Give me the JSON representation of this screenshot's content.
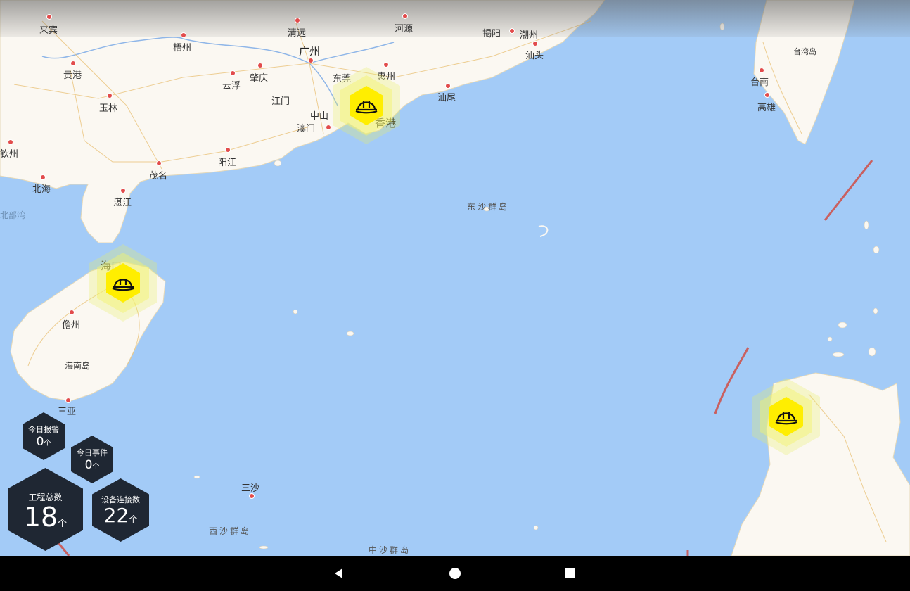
{
  "map": {
    "labels": [
      {
        "text": "来宾",
        "cls": ""
      },
      {
        "text": "梧州",
        "cls": ""
      },
      {
        "text": "清远",
        "cls": ""
      },
      {
        "text": "河源",
        "cls": ""
      },
      {
        "text": "揭阳",
        "cls": ""
      },
      {
        "text": "潮州",
        "cls": ""
      },
      {
        "text": "汕头",
        "cls": ""
      },
      {
        "text": "广州",
        "cls": "big"
      },
      {
        "text": "贵港",
        "cls": ""
      },
      {
        "text": "云浮",
        "cls": ""
      },
      {
        "text": "肇庆",
        "cls": ""
      },
      {
        "text": "东莞",
        "cls": ""
      },
      {
        "text": "惠州",
        "cls": ""
      },
      {
        "text": "玉林",
        "cls": ""
      },
      {
        "text": "江门",
        "cls": ""
      },
      {
        "text": "中山",
        "cls": ""
      },
      {
        "text": "汕尾",
        "cls": ""
      },
      {
        "text": "澳门",
        "cls": ""
      },
      {
        "text": "香港",
        "cls": "big"
      },
      {
        "text": "钦州",
        "cls": ""
      },
      {
        "text": "阳江",
        "cls": ""
      },
      {
        "text": "茂名",
        "cls": ""
      },
      {
        "text": "北海",
        "cls": ""
      },
      {
        "text": "湛江",
        "cls": ""
      },
      {
        "text": "北部湾",
        "cls": "gulf"
      },
      {
        "text": "海口",
        "cls": "big"
      },
      {
        "text": "儋州",
        "cls": ""
      },
      {
        "text": "海南岛",
        "cls": ""
      },
      {
        "text": "三亚",
        "cls": ""
      },
      {
        "text": "三沙",
        "cls": ""
      },
      {
        "text": "西沙群岛",
        "cls": "sea"
      },
      {
        "text": "中沙群岛",
        "cls": "sea"
      },
      {
        "text": "东沙群岛",
        "cls": "sea"
      },
      {
        "text": "台湾岛",
        "cls": ""
      },
      {
        "text": "台南",
        "cls": ""
      },
      {
        "text": "高雄",
        "cls": ""
      }
    ],
    "markers": [
      {
        "name": "project-marker-shenzhen",
        "icon": "hard-hat-icon"
      },
      {
        "name": "project-marker-haikou",
        "icon": "hard-hat-icon"
      },
      {
        "name": "project-marker-luzon",
        "icon": "hard-hat-icon"
      }
    ]
  },
  "stats": {
    "alarms_today": {
      "title": "今日报警",
      "value": "0",
      "unit": "个"
    },
    "events_today": {
      "title": "今日事件",
      "value": "0",
      "unit": "个"
    },
    "projects_total": {
      "title": "工程总数",
      "value": "18",
      "unit": "个"
    },
    "devices_connected": {
      "title": "设备连接数",
      "value": "22",
      "unit": "个"
    }
  },
  "navbar": {
    "back": "back-triangle-icon",
    "home": "home-circle-icon",
    "recents": "recents-square-icon"
  },
  "colors": {
    "sea": "#a3cbf7",
    "land": "#fbf8f2",
    "marker": "#ffee00",
    "stat_bg": "#1f2733"
  }
}
